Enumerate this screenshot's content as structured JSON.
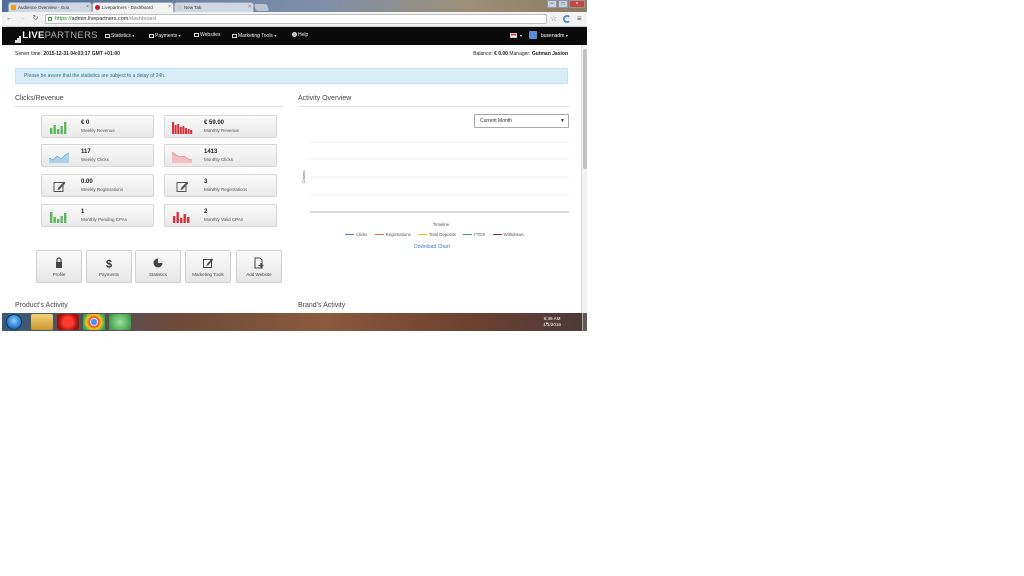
{
  "browser": {
    "tabs": [
      {
        "label": "Audience Overview - Goo",
        "active": false
      },
      {
        "label": "Livepartners - Dashboard",
        "active": true
      },
      {
        "label": "New Tab",
        "active": false
      }
    ],
    "url": {
      "scheme": "https://",
      "host": "admin.livepartners.com",
      "path": "/dashboard"
    }
  },
  "site_nav": {
    "logo_live": "LIVE",
    "logo_partners": "PARTNERS",
    "items": [
      {
        "label": "Statistics",
        "has_caret": true
      },
      {
        "label": "Payments",
        "has_caret": true
      },
      {
        "label": "Websites",
        "has_caret": false
      },
      {
        "label": "Marketing Tools",
        "has_caret": true
      },
      {
        "label": "Help",
        "has_caret": false
      }
    ],
    "username": "busenadm"
  },
  "header": {
    "server_time_label": "Server time:",
    "server_time_value": "2015-12-31 04:03:17 GMT +01:00",
    "balance_label": "Balance:",
    "balance_value": "€ 0.00",
    "manager_label": "Manager:",
    "manager_value": "Gutman Jaslon"
  },
  "alert": "Please be aware that the statistics are subject to a delay of 24h.",
  "clicks_revenue": {
    "title": "Clicks/Revenue",
    "stats": [
      {
        "value": "€ 0",
        "label": "Weekly Revenue",
        "icon": "bar-chart-green-icon",
        "color": "#5cb85c"
      },
      {
        "value": "€ 59.00",
        "label": "Monthly Revenue",
        "icon": "bar-chart-red-icon",
        "color": "#d9303a"
      },
      {
        "value": "117",
        "label": "Weekly Clicks",
        "icon": "area-chart-blue-icon",
        "color": "#8ec3e6"
      },
      {
        "value": "1413",
        "label": "Monthly Clicks",
        "icon": "area-chart-pink-icon",
        "color": "#f2a7ad"
      },
      {
        "value": "0.00",
        "label": "Weekly Registrations",
        "icon": "edit-icon",
        "color": "#555555"
      },
      {
        "value": "3",
        "label": "Monthly Registrations",
        "icon": "edit-icon",
        "color": "#555555"
      },
      {
        "value": "1",
        "label": "Monthly Pending CPAs",
        "icon": "bar-chart-green-icon",
        "color": "#5cb85c"
      },
      {
        "value": "2",
        "label": "Monthly Valid CPAs",
        "icon": "bar-chart-red-icon",
        "color": "#d9303a"
      }
    ]
  },
  "quick_links": [
    {
      "label": "Profile",
      "icon": "lock-icon"
    },
    {
      "label": "Payments",
      "icon": "dollar-icon"
    },
    {
      "label": "Statistics",
      "icon": "pie-chart-icon"
    },
    {
      "label": "Marketing Tools",
      "icon": "edit-icon"
    },
    {
      "label": "Add Website",
      "icon": "add-file-icon"
    }
  ],
  "activity": {
    "title": "Activity Overview",
    "period_selected": "Current Month",
    "y_axis_label": "Counts",
    "x_axis_label": "Timeline",
    "legend": [
      {
        "name": "Clicks",
        "color": "#4a7fd6"
      },
      {
        "name": "Registrations",
        "color": "#e2703a"
      },
      {
        "name": "Total Deposits",
        "color": "#f0c22a"
      },
      {
        "name": "FTDS",
        "color": "#3aa45a"
      },
      {
        "name": "Withdraws",
        "color": "#8a2a5a"
      }
    ],
    "download_label": "Download Chart"
  },
  "lower_sections": {
    "products": "Product's Activity",
    "brands": "Brand's Activity"
  },
  "taskbar": {
    "time": "8:39 AM",
    "date": "1/1/2016"
  }
}
